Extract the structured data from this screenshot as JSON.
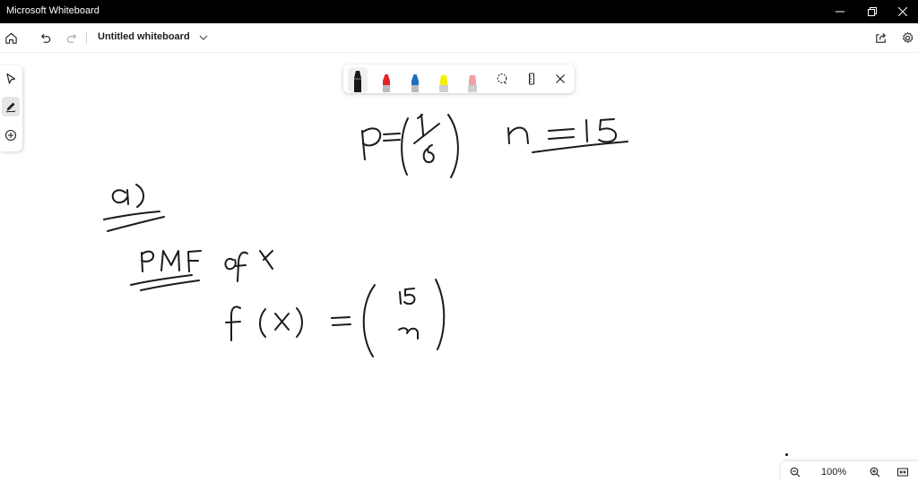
{
  "window": {
    "title": "Microsoft Whiteboard"
  },
  "appbar": {
    "document_title": "Untitled whiteboard",
    "icons": [
      "home-icon",
      "undo-icon",
      "redo-icon",
      "chevron-down-icon",
      "share-icon",
      "settings-icon"
    ]
  },
  "sidebar": {
    "tools": [
      "select-icon",
      "pen-icon",
      "add-icon"
    ],
    "active_tool": "pen"
  },
  "pen_toolbar": {
    "pens": [
      {
        "name": "black-pen",
        "color": "#1a1a1a"
      },
      {
        "name": "red-pen",
        "color": "#e3232c"
      },
      {
        "name": "blue-pen",
        "color": "#1f6fc0"
      },
      {
        "name": "yellow-highlighter",
        "color": "#f4f000"
      },
      {
        "name": "pink-highlighter",
        "color": "#f0a0a6"
      }
    ],
    "selected_pen": "black-pen",
    "tools": [
      "lasso-icon",
      "ruler-icon",
      "close-icon"
    ]
  },
  "zoom": {
    "level": "100%"
  },
  "colors": {
    "titlebar_bg": "#000000",
    "ink": "#1b1b1b"
  }
}
